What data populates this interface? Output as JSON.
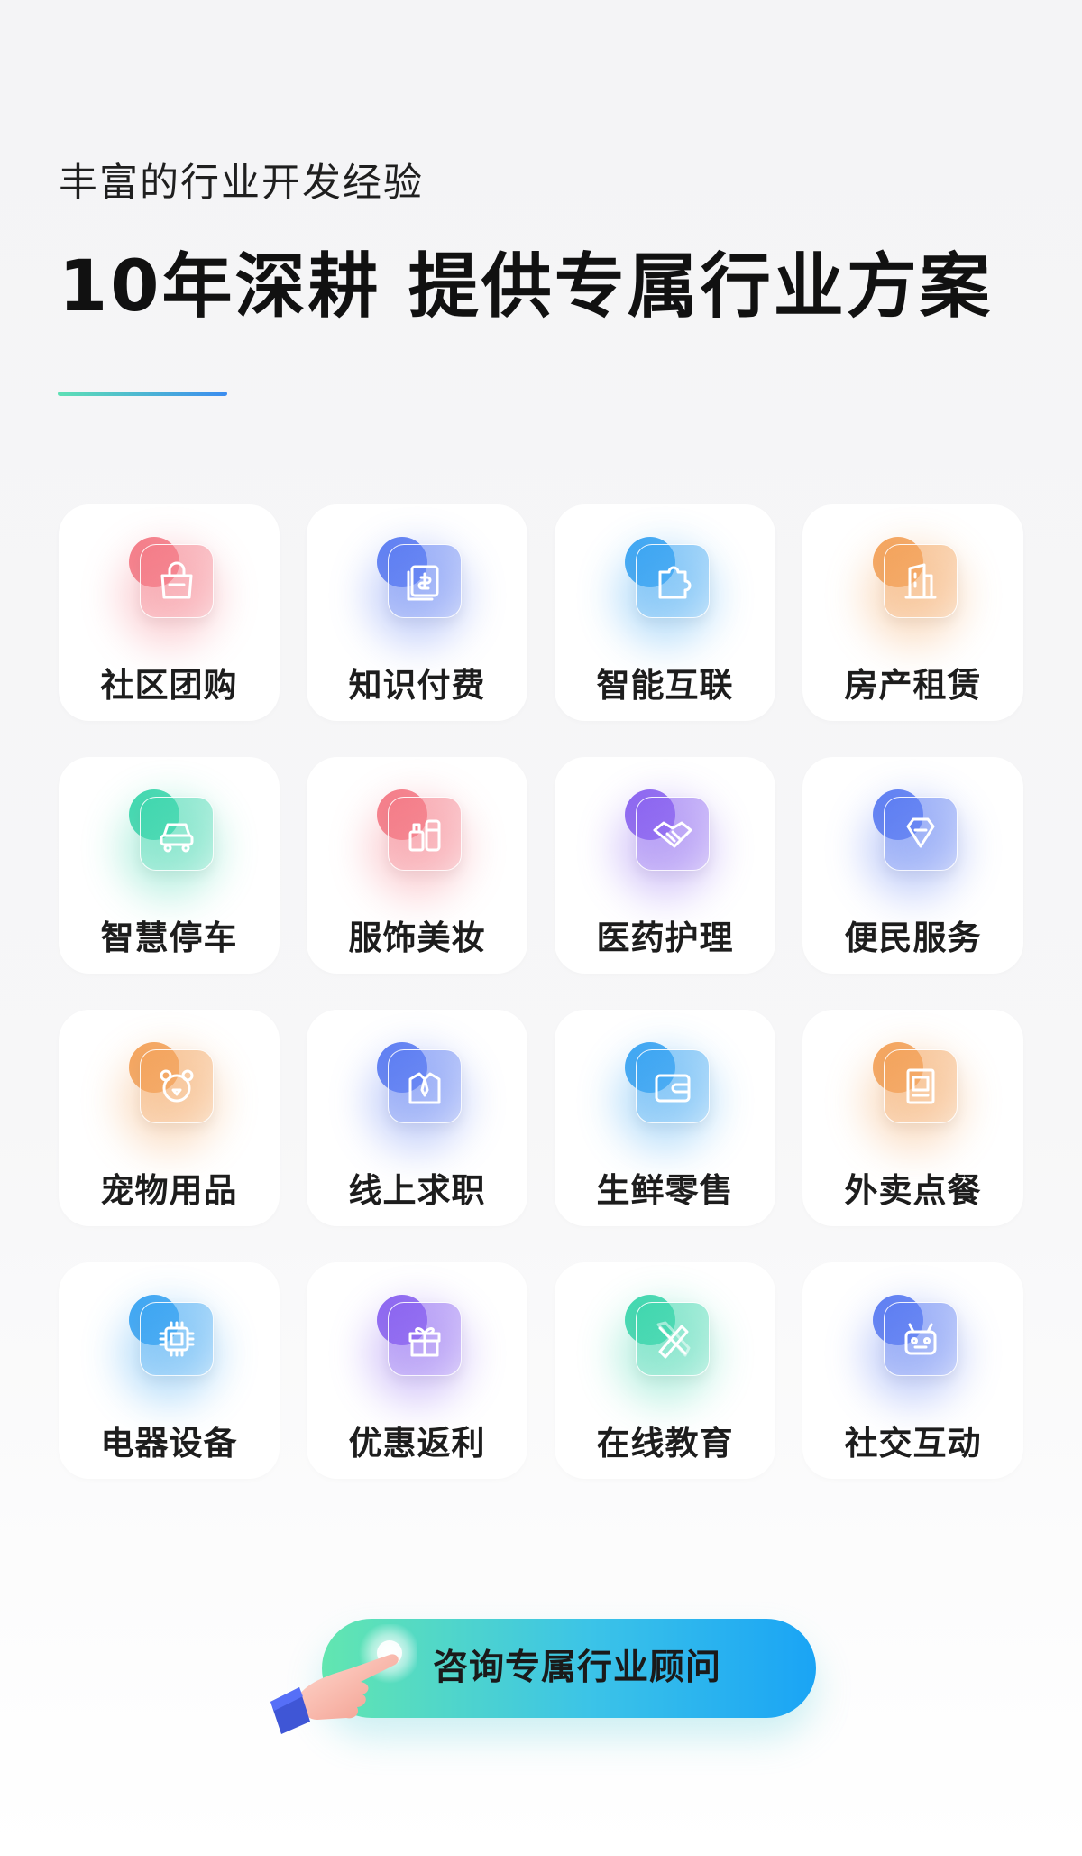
{
  "header": {
    "subtitle": "丰富的行业开发经验",
    "headline": "10年深耕 提供专属行业方案"
  },
  "industries": [
    {
      "label": "社区团购",
      "icon": "shopping-bag-icon",
      "color": "#f47a86"
    },
    {
      "label": "知识付费",
      "icon": "paid-book-icon",
      "color": "#5b7cf2"
    },
    {
      "label": "智能互联",
      "icon": "puzzle-icon",
      "color": "#3aa4f2"
    },
    {
      "label": "房产租赁",
      "icon": "building-icon",
      "color": "#f3a25a"
    },
    {
      "label": "智慧停车",
      "icon": "car-icon",
      "color": "#3dd6ad"
    },
    {
      "label": "服饰美妆",
      "icon": "cosmetics-icon",
      "color": "#f47a86"
    },
    {
      "label": "医药护理",
      "icon": "handshake-icon",
      "color": "#8a63f0"
    },
    {
      "label": "便民服务",
      "icon": "diamond-icon",
      "color": "#5b7cf2"
    },
    {
      "label": "宠物用品",
      "icon": "bear-icon",
      "color": "#f3a25a"
    },
    {
      "label": "线上求职",
      "icon": "suit-tie-icon",
      "color": "#5b7cf2"
    },
    {
      "label": "生鲜零售",
      "icon": "wallet-icon",
      "color": "#3aa4f2"
    },
    {
      "label": "外卖点餐",
      "icon": "door-icon",
      "color": "#f3a25a"
    },
    {
      "label": "电器设备",
      "icon": "chip-icon",
      "color": "#3aa4f2"
    },
    {
      "label": "优惠返利",
      "icon": "gift-icon",
      "color": "#8a63f0"
    },
    {
      "label": "在线教育",
      "icon": "pencil-ruler-icon",
      "color": "#3dd6ad"
    },
    {
      "label": "社交互动",
      "icon": "robot-icon",
      "color": "#5b7cf2"
    }
  ],
  "cta": {
    "label": "咨询专属行业顾问",
    "icon": "pointing-hand-icon"
  }
}
